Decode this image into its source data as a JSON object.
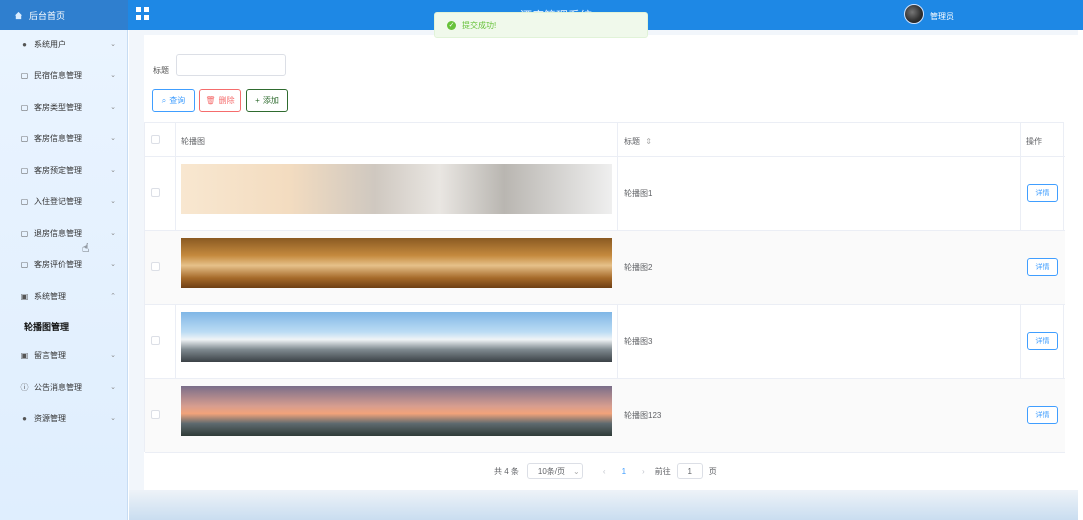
{
  "header": {
    "home_label": "后台首页",
    "app_title": "酒店管理系统",
    "username": "管理员",
    "icons": {
      "home": "home-icon",
      "menu": "grid-icon",
      "avatar": "user-avatar"
    }
  },
  "toast": {
    "message": "提交成功!"
  },
  "sidebar": {
    "items": [
      {
        "label": "系统用户",
        "icon": "user-icon"
      },
      {
        "label": "民宿信息管理",
        "icon": "doc-icon"
      },
      {
        "label": "客房类型管理",
        "icon": "doc-icon"
      },
      {
        "label": "客房信息管理",
        "icon": "doc-icon"
      },
      {
        "label": "客房预定管理",
        "icon": "doc-icon"
      },
      {
        "label": "入住登记管理",
        "icon": "doc-icon"
      },
      {
        "label": "退房信息管理",
        "icon": "doc-icon"
      },
      {
        "label": "客房评价管理",
        "icon": "doc-icon"
      },
      {
        "label": "系统管理",
        "icon": "image-icon"
      },
      {
        "label": "留言管理",
        "icon": "image-icon"
      },
      {
        "label": "公告消息管理",
        "icon": "info-icon"
      },
      {
        "label": "资源管理",
        "icon": "pin-icon"
      }
    ],
    "active_sub": "轮播图管理"
  },
  "filters": {
    "title_label": "标题",
    "title_value": "",
    "title_placeholder": ""
  },
  "toolbar": {
    "query_label": "查询",
    "delete_label": "删除",
    "add_label": "添加"
  },
  "table": {
    "columns": {
      "image": "轮播图",
      "title": "标题",
      "actions": "操作"
    },
    "detail_label": "详情",
    "rows": [
      {
        "title": "轮播图1"
      },
      {
        "title": "轮播图2"
      },
      {
        "title": "轮播图3"
      },
      {
        "title": "轮播图123"
      }
    ]
  },
  "pagination": {
    "total": "共 4 条",
    "page_size": "10条/页",
    "current_page": "1",
    "goto_prefix": "前往",
    "goto_value": "1",
    "goto_suffix": "页"
  },
  "colors": {
    "primary": "#1e88e5",
    "link": "#409eff",
    "danger": "#f56c6c",
    "success": "#67c23a",
    "add": "#2f6b2f"
  }
}
